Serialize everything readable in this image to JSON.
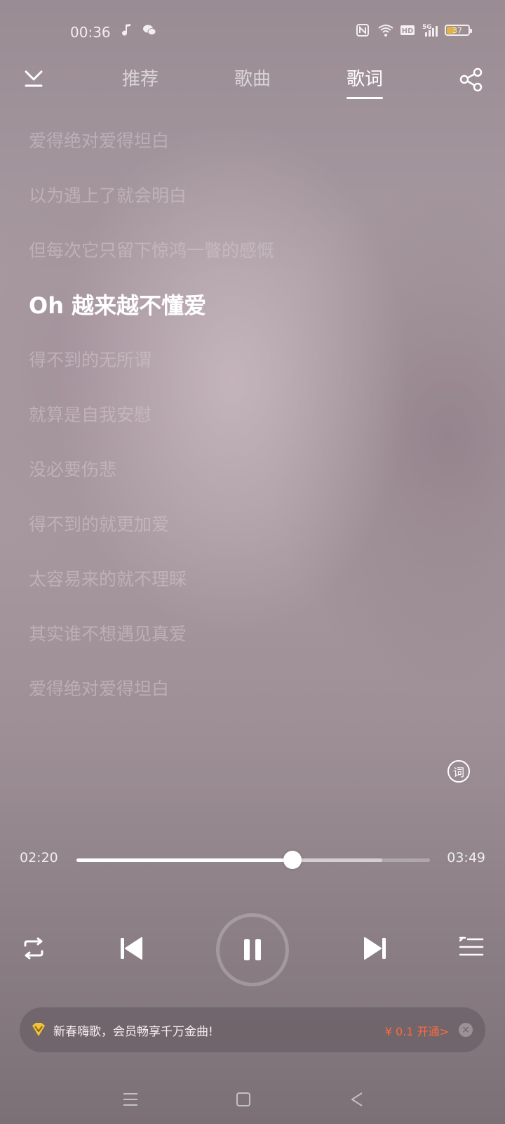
{
  "status_bar": {
    "time": "00:36",
    "battery_level": "37",
    "battery_fraction": 0.37,
    "icons": [
      "music-note-icon",
      "wechat-icon",
      "nfc-icon",
      "wifi-icon",
      "hd-icon",
      "5g-signal-icon",
      "battery-icon"
    ]
  },
  "nav": {
    "tabs": [
      {
        "label": "推荐",
        "active": false
      },
      {
        "label": "歌曲",
        "active": false
      },
      {
        "label": "歌词",
        "active": true
      }
    ],
    "back_icon": "chevron-down-icon",
    "share_icon": "share-icon"
  },
  "lyrics": {
    "lines": [
      "爱得绝对爱得坦白",
      "以为遇上了就会明白",
      "但每次它只留下惊鸿一瞥的感慨",
      "Oh 越来越不懂爱",
      "得不到的无所谓",
      "就算是自我安慰",
      "没必要伤悲",
      "得不到的就更加爱",
      "太容易来的就不理睬",
      "其实谁不想遇见真爱",
      "爱得绝对爱得坦白"
    ],
    "current_index": 3,
    "mode_button_label": "词"
  },
  "player": {
    "elapsed": "02:20",
    "total": "03:49",
    "progress_fraction": 0.611,
    "buffered_fraction": 0.865,
    "state": "playing",
    "controls": [
      "repeat-icon",
      "previous-icon",
      "pause-icon",
      "next-icon",
      "playlist-icon"
    ]
  },
  "promo": {
    "text": "新春嗨歌，会员畅享千万金曲!",
    "cta": "¥ 0.1 开通>",
    "close": "×",
    "icon": "vip-diamond-icon"
  },
  "colors": {
    "accent_text": "#ffffff",
    "promo_cta": "#ff6a3c",
    "vip_gold": "#f2c23a"
  }
}
